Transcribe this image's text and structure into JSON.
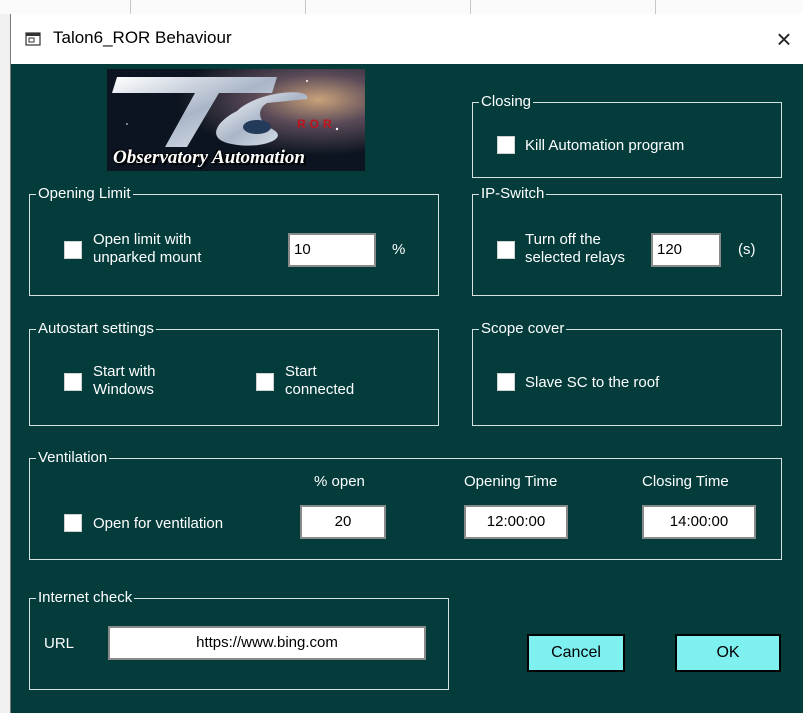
{
  "window": {
    "title": "Talon6_ROR Behaviour",
    "close_label": "×"
  },
  "logo": {
    "caption": "Observatory Automation",
    "badge": "ROR"
  },
  "opening_limit": {
    "legend": "Opening Limit",
    "checkbox_line1": "Open limit with",
    "checkbox_line2": "unparked mount",
    "checked": false,
    "value": "10",
    "unit": "%"
  },
  "closing": {
    "legend": "Closing",
    "checkbox_label": "Kill Automation program",
    "checked": false
  },
  "ip_switch": {
    "legend": "IP-Switch",
    "checkbox_line1": "Turn off the",
    "checkbox_line2": "selected relays",
    "checked": false,
    "value": "120",
    "unit": "(s)"
  },
  "autostart": {
    "legend": "Autostart settings",
    "start_windows_line1": "Start with",
    "start_windows_line2": "Windows",
    "start_windows_checked": false,
    "start_connected_line1": "Start",
    "start_connected_line2": "connected",
    "start_connected_checked": false
  },
  "scope_cover": {
    "legend": "Scope cover",
    "checkbox_label": "Slave SC to the roof",
    "checked": false
  },
  "ventilation": {
    "legend": "Ventilation",
    "checkbox_label": "Open for ventilation",
    "checked": false,
    "percent_header": "% open",
    "percent_value": "20",
    "opening_time_header": "Opening Time",
    "opening_time_value": "12:00:00",
    "closing_time_header": "Closing Time",
    "closing_time_value": "14:00:00"
  },
  "internet_check": {
    "legend": "Internet check",
    "url_label": "URL",
    "url_value": "https://www.bing.com"
  },
  "buttons": {
    "cancel": "Cancel",
    "ok": "OK"
  },
  "colors": {
    "background": "#043c3c",
    "button": "#7ff0f0",
    "text": "#ffffff"
  }
}
